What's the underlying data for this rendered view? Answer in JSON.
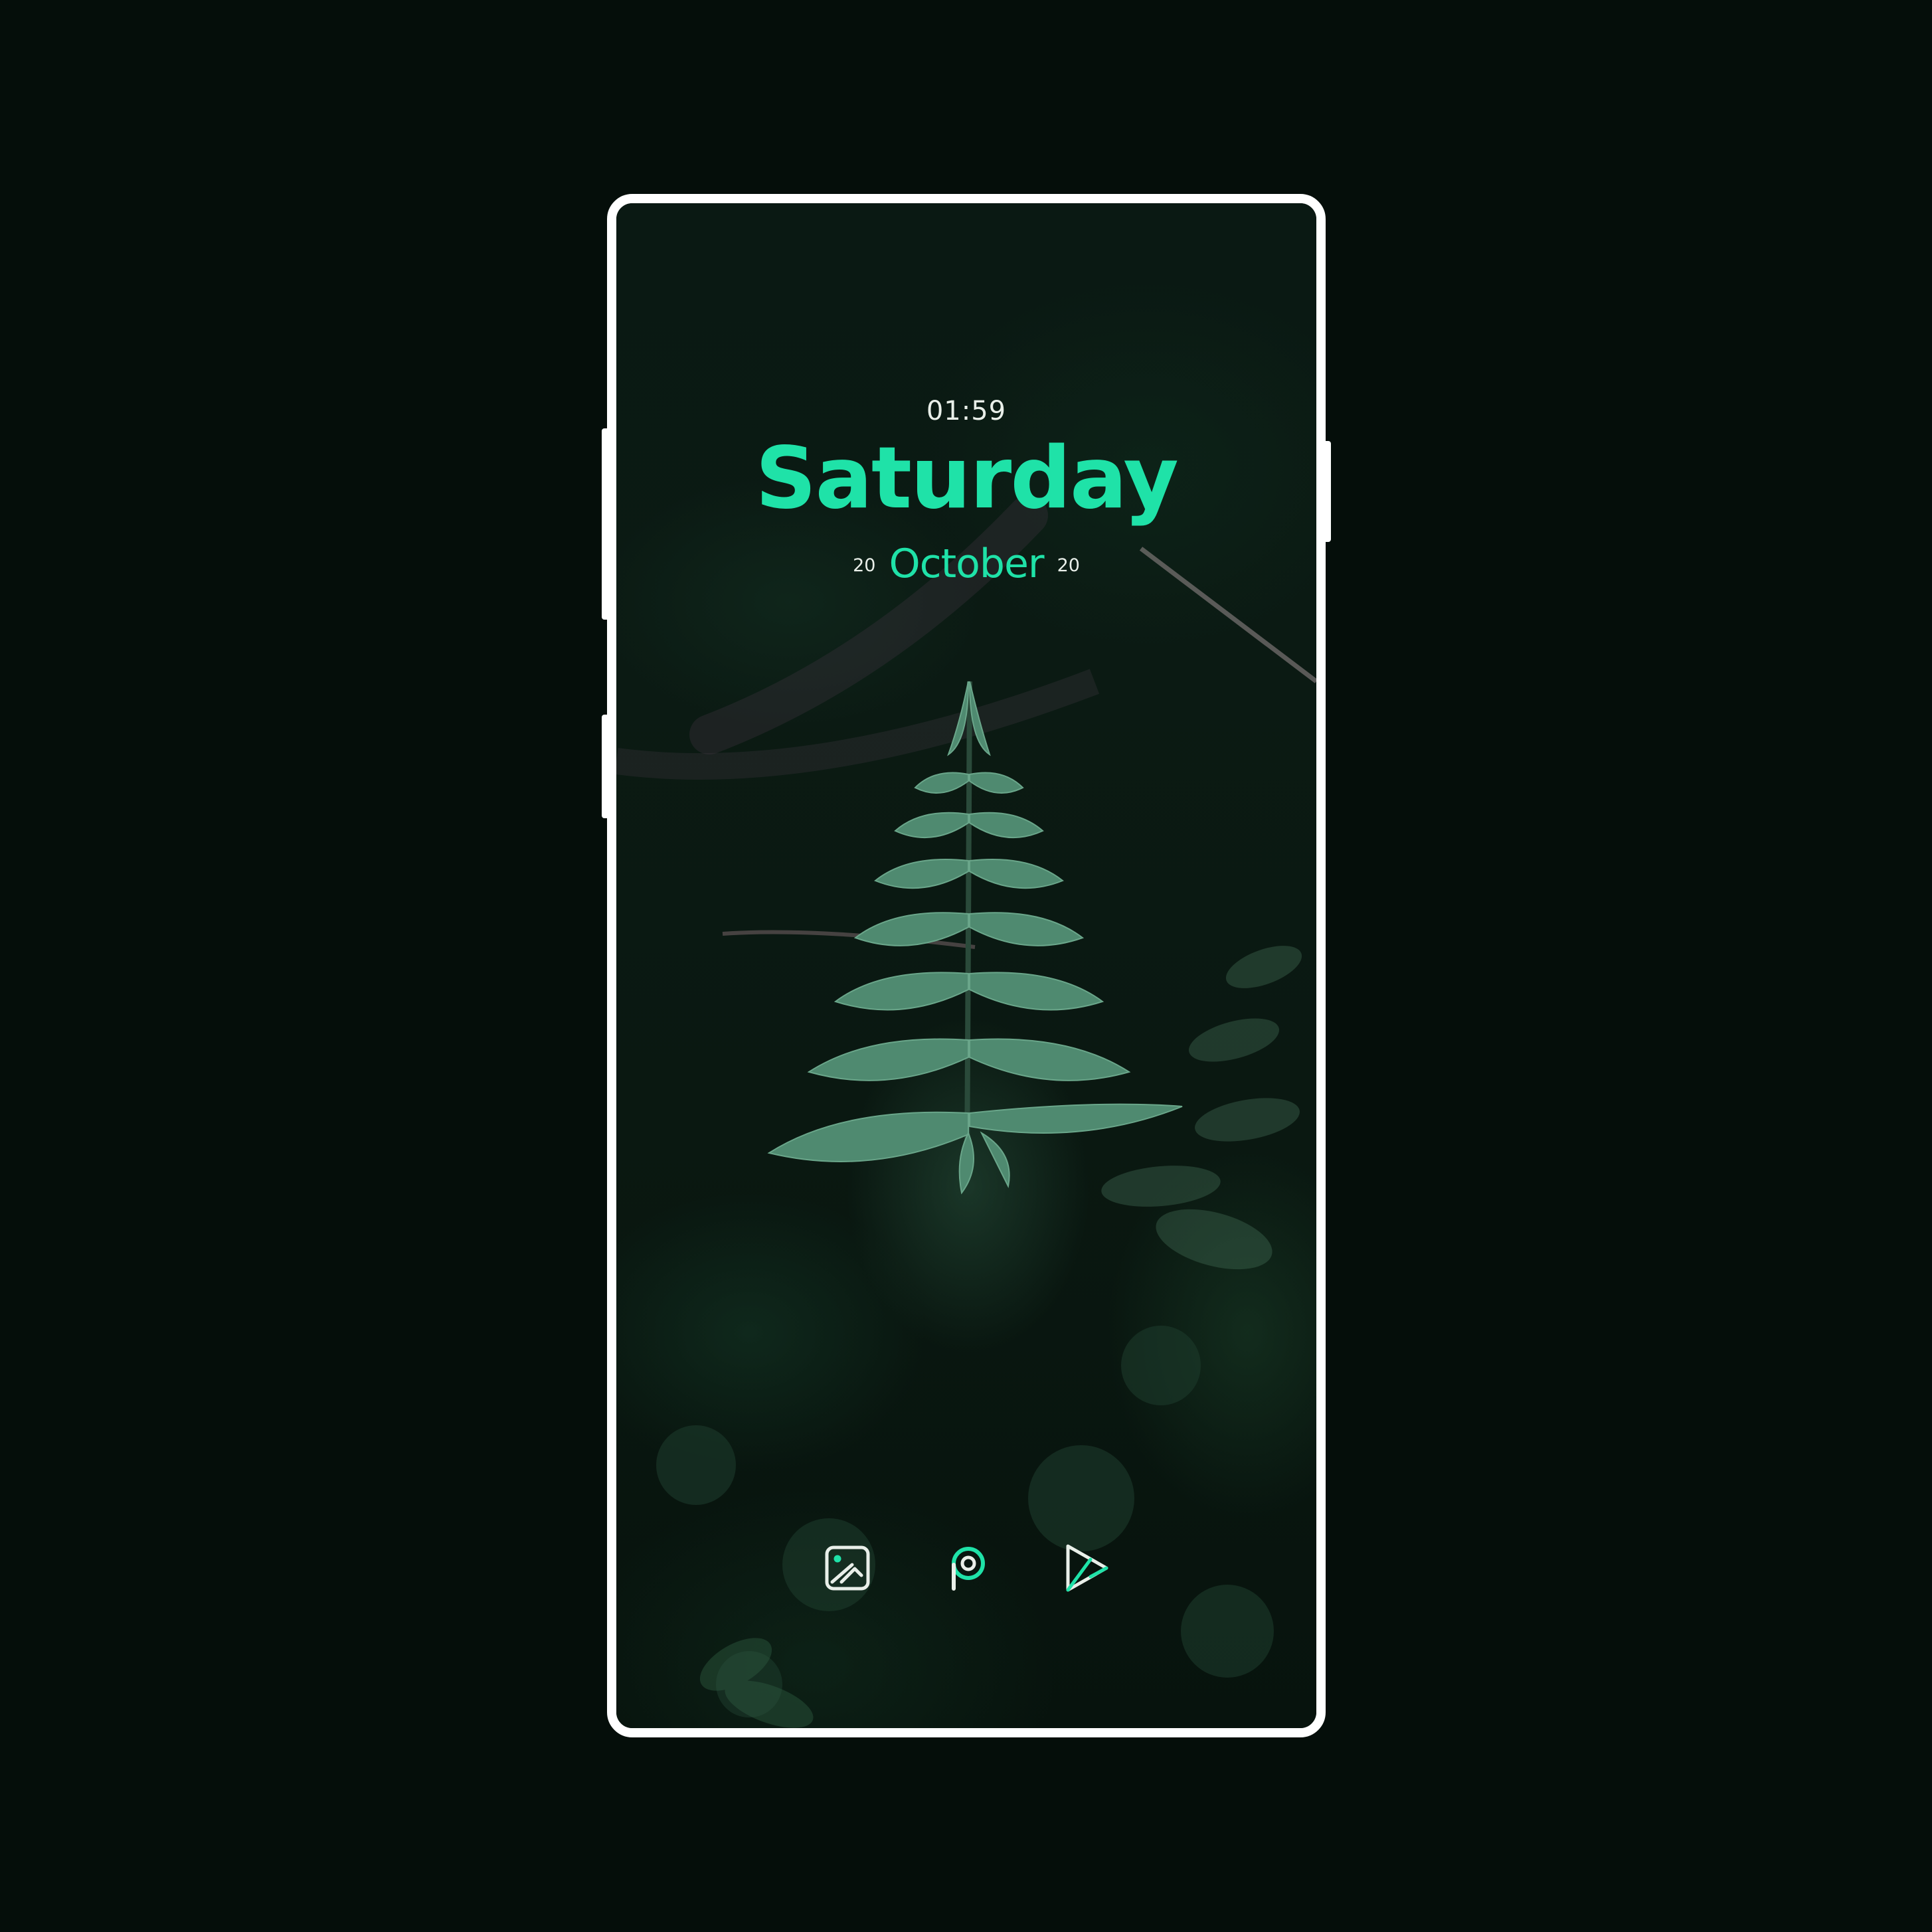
{
  "lockscreen": {
    "time": "01:59",
    "day": "Saturday",
    "date_left": "20",
    "month": "October",
    "date_right": "20"
  },
  "dock": {
    "apps": [
      {
        "name": "gallery",
        "icon": "gallery-icon"
      },
      {
        "name": "picsart",
        "icon": "picsart-icon"
      },
      {
        "name": "play-store",
        "icon": "play-store-icon"
      }
    ]
  },
  "colors": {
    "background": "#050e0a",
    "frame": "#ffffff",
    "accent": "#1fe2a8",
    "text": "#e9efe9"
  }
}
